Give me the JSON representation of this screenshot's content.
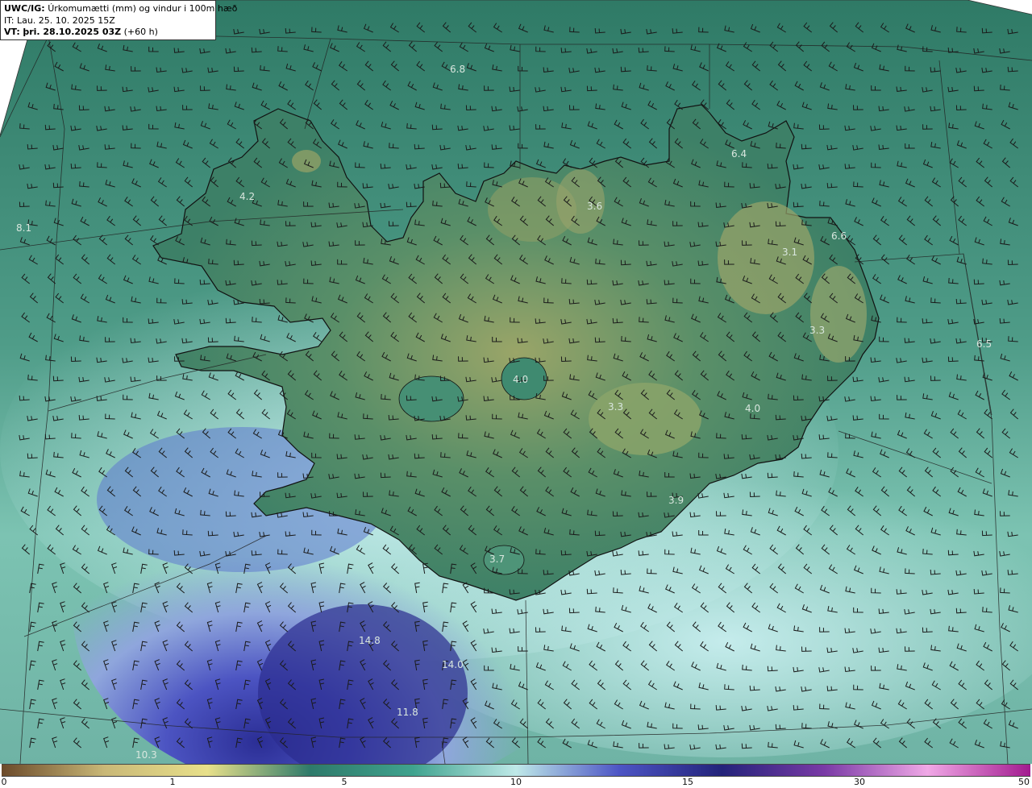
{
  "header": {
    "model_label": "UWC/IG:",
    "title": "Úrkomumætti (mm) og vindur i 100m hæð",
    "init_time": "IT: Lau. 25. 10. 2025 15Z",
    "valid_label": "VT:",
    "valid_time": "þri. 28.10.2025 03Z",
    "lead_time": "(+60 h)"
  },
  "colorbar": {
    "ticks": [
      "0",
      "1",
      "5",
      "10",
      "15",
      "30",
      "50"
    ],
    "colors": [
      "#6b4a2a",
      "#c9b877",
      "#e8e08a",
      "#2e7a6a",
      "#3fa38e",
      "#bfe9e8",
      "#4d55c5",
      "#23237a",
      "#7a3aa6",
      "#f0a8e6",
      "#a21b8f"
    ]
  },
  "labels": [
    {
      "text": "6.8",
      "color": "#d8e6de"
    },
    {
      "text": "8.1",
      "color": "#d8e6de"
    },
    {
      "text": "4.2",
      "color": "#d8e6de"
    },
    {
      "text": "6.4",
      "color": "#d8e6de"
    },
    {
      "text": "3.6",
      "color": "#d8e6de"
    },
    {
      "text": "3.1",
      "color": "#d8e6de"
    },
    {
      "text": "6.6",
      "color": "#d8e6de"
    },
    {
      "text": "3.3",
      "color": "#d8e6de"
    },
    {
      "text": "6.5",
      "color": "#d8e6de"
    },
    {
      "text": "4.0",
      "color": "#d8e6de"
    },
    {
      "text": "3.3",
      "color": "#d8e6de"
    },
    {
      "text": "4.0",
      "color": "#d8e6de"
    },
    {
      "text": "3.9",
      "color": "#d8e6de"
    },
    {
      "text": "3.7",
      "color": "#d8e6de"
    },
    {
      "text": "14.8",
      "color": "#d8e6de"
    },
    {
      "text": "14.0",
      "color": "#d8e6de"
    },
    {
      "text": "11.8",
      "color": "#d8e6de"
    },
    {
      "text": "10.3",
      "color": "#d8e6de"
    }
  ]
}
